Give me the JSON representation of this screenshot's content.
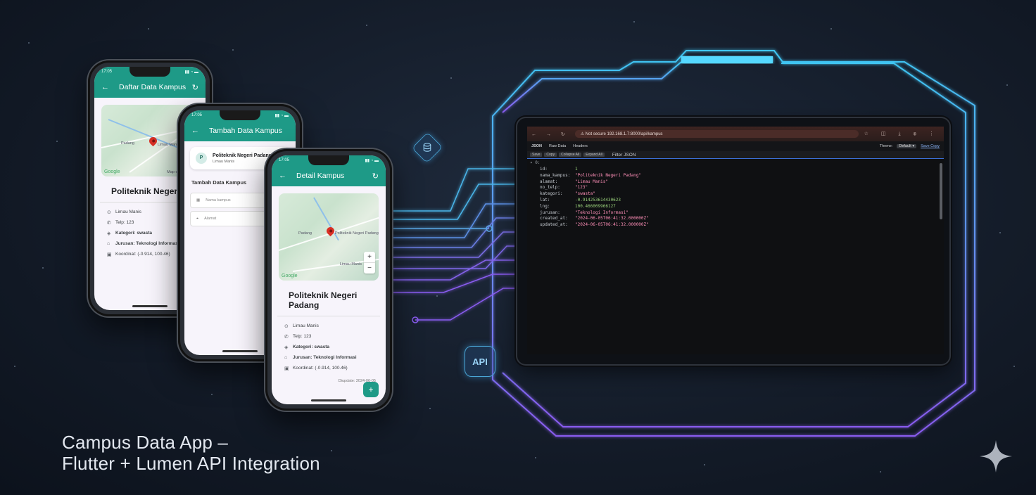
{
  "caption": {
    "line1": "Campus Data App –",
    "line2": "Flutter + Lumen API Integration"
  },
  "phone1": {
    "status_time": "17:05",
    "appbar_title": "Daftar Data Kampus",
    "map_label": "Padang",
    "map_label2": "Limau Manis",
    "google": "Google",
    "map_footer": "Map data ©2024",
    "campus_name": "Politeknik Negeri P",
    "info": [
      {
        "icon": "⊙",
        "text": "Limau Manis",
        "bold": false
      },
      {
        "icon": "✆",
        "text": "Telp: 123",
        "bold": false
      },
      {
        "icon": "◈",
        "text": "Kategori: swasta",
        "bold": true
      },
      {
        "icon": "⌂",
        "text": "Jurusan: Teknologi Informasi",
        "bold": true
      },
      {
        "icon": "▣",
        "text": "Koordinat: (-0.914, 100.46)",
        "bold": false
      }
    ],
    "updated": "Dip..."
  },
  "phone2": {
    "status_time": "17:05",
    "appbar_title": "Tambah Data Kampus",
    "card_avatar": "P",
    "card_title": "Politeknik Negeri Padang",
    "card_sub": "Limau Manis",
    "section": "Tambah Data Kampus",
    "field1": "Nama kampus",
    "field2": "Alamat"
  },
  "phone3": {
    "status_time": "17:05",
    "appbar_title": "Detail Kampus",
    "map_label": "Politeknik Negeri Padang",
    "map_label2": "Padang",
    "google": "Google",
    "map_footer": "Limau Manis",
    "zoom_in": "+",
    "zoom_out": "−",
    "campus_name": "Politeknik Negeri Padang",
    "info": [
      {
        "icon": "⊙",
        "text": "Limau Manis",
        "bold": false
      },
      {
        "icon": "✆",
        "text": "Telp: 123",
        "bold": false
      },
      {
        "icon": "◈",
        "text": "Kategori: swasta",
        "bold": true
      },
      {
        "icon": "⌂",
        "text": "Jurusan: Teknologi Informasi",
        "bold": true
      },
      {
        "icon": "▣",
        "text": "Koordinat: (-0.914, 100.46)",
        "bold": false
      }
    ],
    "updated": "Diupdate: 2024-06-05",
    "fab": "+"
  },
  "browser": {
    "nav": "← → ↻",
    "url": "⚠ Not secure   192.168.1.7:8000/api/kampus",
    "actions": "☆ ◫ ⤓ ⦿ ⋮",
    "tabs": [
      "JSON",
      "Raw Data",
      "Headers"
    ],
    "theme_label": "Theme:",
    "theme_value": "Default ▾",
    "link": "Save Copy",
    "pills": [
      "Save",
      "Copy",
      "Collapse All",
      "Expand All",
      "Filter JSON"
    ],
    "raw_label": "Filter JSON",
    "root": "▾ 0:",
    "json": [
      {
        "k": "id:",
        "v": "1",
        "cls": "num"
      },
      {
        "k": "nama_kampus:",
        "v": "\"Politeknik Negeri Padang\"",
        "cls": ""
      },
      {
        "k": "alamat:",
        "v": "\"Limau Manis\"",
        "cls": ""
      },
      {
        "k": "no_telp:",
        "v": "\"123\"",
        "cls": ""
      },
      {
        "k": "kategori:",
        "v": "\"swasta\"",
        "cls": ""
      },
      {
        "k": "lat:",
        "v": "-0.914253614430623",
        "cls": "green"
      },
      {
        "k": "lng:",
        "v": "100.466009966127",
        "cls": "green"
      },
      {
        "k": "jurusan:",
        "v": "\"Teknologi Informasi\"",
        "cls": ""
      },
      {
        "k": "created_at:",
        "v": "\"2024-06-05T06:41:32.000000Z\"",
        "cls": ""
      },
      {
        "k": "updated_at:",
        "v": "\"2024-06-05T06:41:32.000000Z\"",
        "cls": ""
      }
    ]
  },
  "hud": {
    "api_label": "API"
  },
  "colors": {
    "teal": "#1e9a87",
    "cyan": "#3fc6f2",
    "purple": "#8a5cf0"
  }
}
